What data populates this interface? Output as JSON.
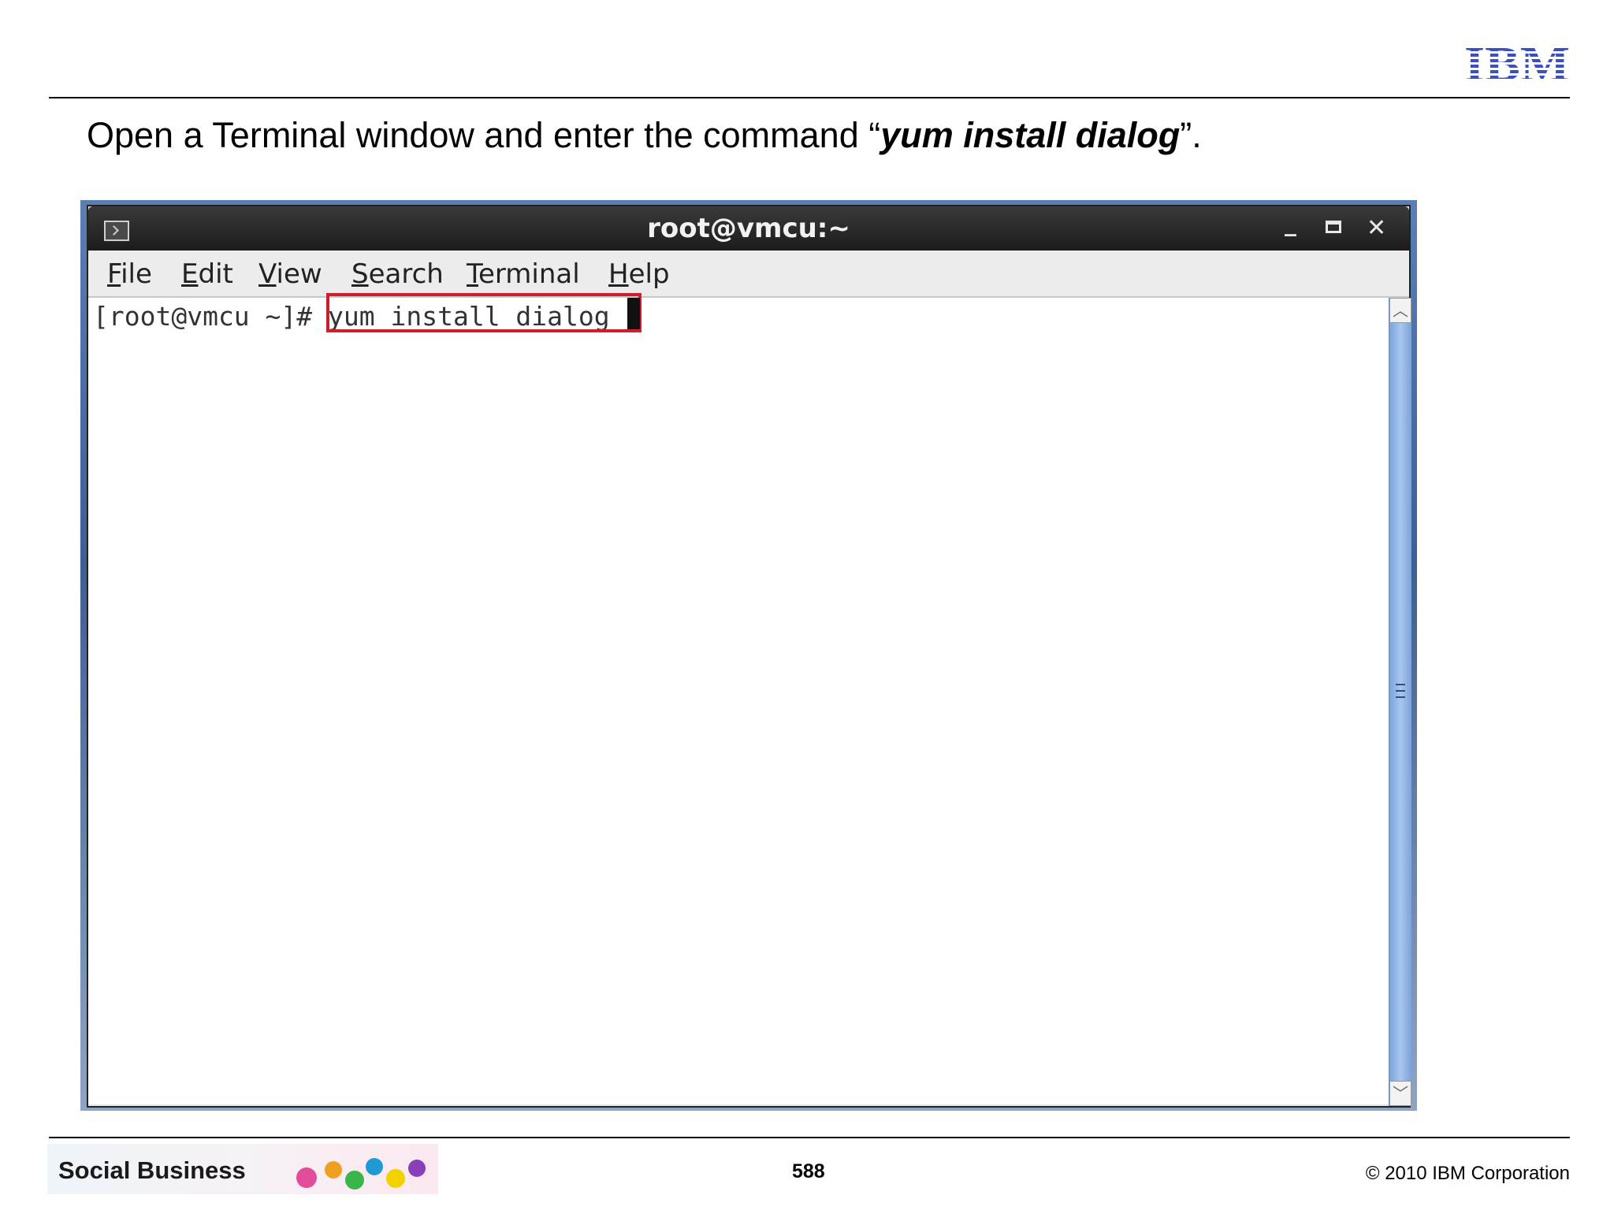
{
  "header": {
    "logo_text": "IBM",
    "logo_color": "#3c4fbf"
  },
  "instruction": {
    "prefix": "Open a Terminal window and enter the command “",
    "command": "yum install dialog",
    "suffix": "”."
  },
  "terminal": {
    "title": "root@vmcu:~",
    "menu": [
      {
        "first": "F",
        "rest": "ile"
      },
      {
        "first": "E",
        "rest": "dit"
      },
      {
        "first": "V",
        "rest": "iew"
      },
      {
        "first": "S",
        "rest": "earch"
      },
      {
        "first": "T",
        "rest": "erminal"
      },
      {
        "first": "H",
        "rest": "elp"
      }
    ],
    "prompt": "[root@vmcu ~]# ",
    "input_command": "yum install dialog",
    "highlight_color": "#cc1f2a",
    "icons": {
      "app": "terminal-icon",
      "minimize": "minimize-icon",
      "maximize": "maximize-icon",
      "close": "close-icon",
      "scroll_up": "chevron-up-icon",
      "scroll_down": "chevron-down-icon"
    }
  },
  "footer": {
    "brand": "Social Business",
    "page_number": "588",
    "copyright": "© 2010 IBM Corporation"
  }
}
